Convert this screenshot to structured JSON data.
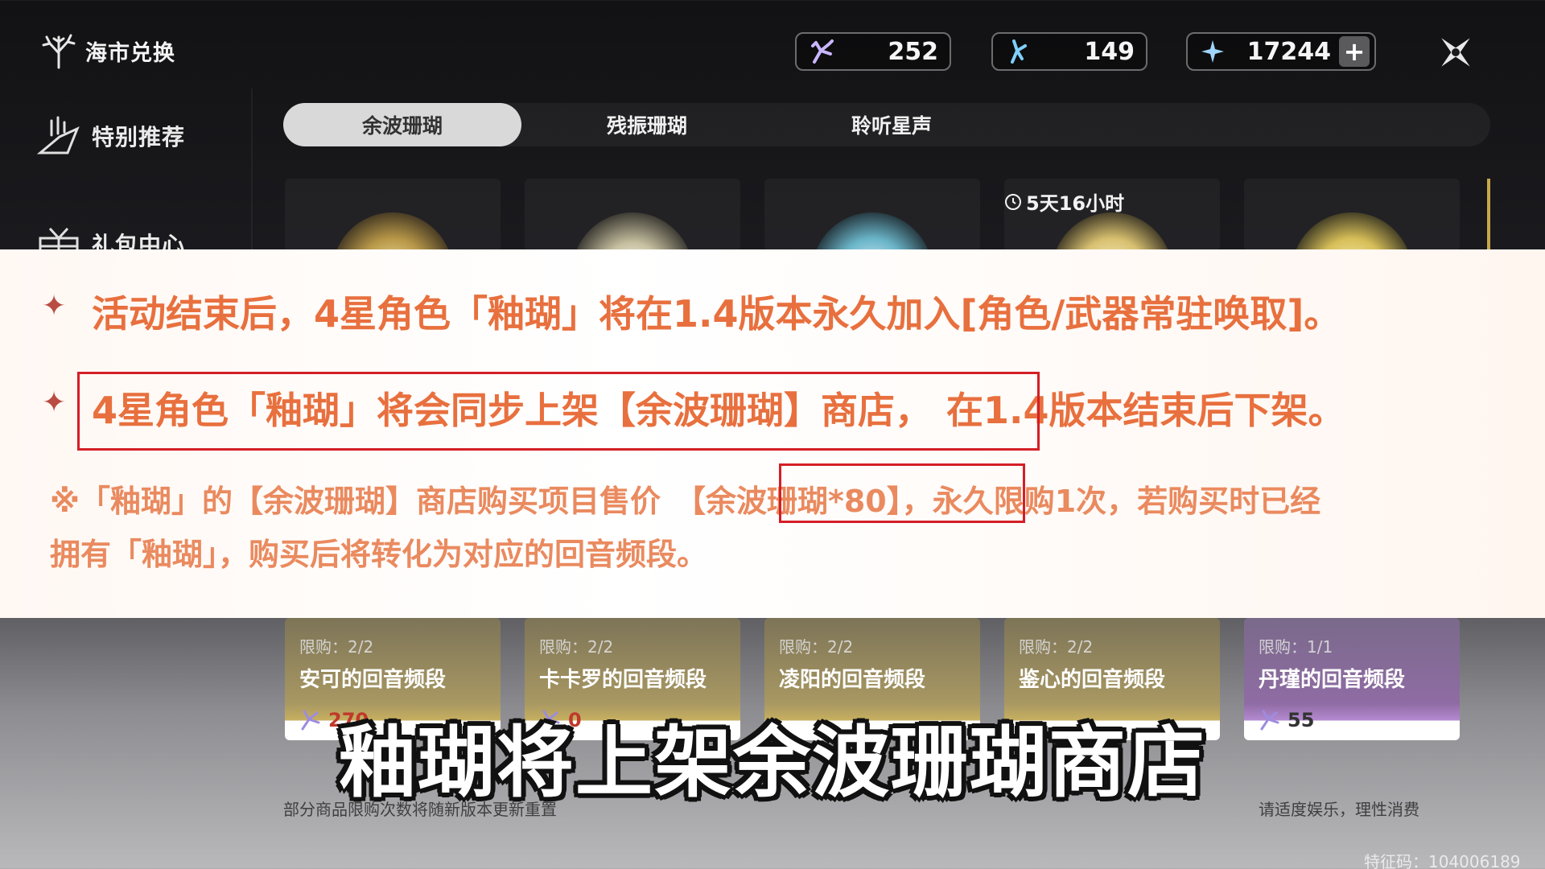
{
  "header": {
    "shop_title": "海市兑换"
  },
  "currencies": [
    {
      "icon": "coral-currency-icon",
      "value": "252"
    },
    {
      "icon": "blue-coral-currency-icon",
      "value": "149"
    },
    {
      "icon": "star-currency-icon",
      "value": "17244",
      "plus": "+"
    }
  ],
  "sidebar": {
    "items": [
      {
        "label": "特别推荐"
      },
      {
        "label": "礼包中心"
      }
    ]
  },
  "tabs": [
    {
      "label": "余波珊瑚",
      "active": true
    },
    {
      "label": "残振珊瑚",
      "active": false
    },
    {
      "label": "聆听星声",
      "active": false
    }
  ],
  "timer": {
    "text": "5天16小时"
  },
  "cards": [
    {
      "limit": "限购：2/2",
      "name": "安可的回音频段",
      "price": "270"
    },
    {
      "limit": "限购：2/2",
      "name": "卡卡罗的回音频段",
      "price": "0"
    },
    {
      "limit": "限购：2/2",
      "name": "凌阳的回音频段",
      "price": ""
    },
    {
      "limit": "限购：2/2",
      "name": "鉴心的回音频段",
      "price": ""
    },
    {
      "limit": "限购：1/1",
      "name": "丹瑾的回音频段",
      "price": "55"
    }
  ],
  "notice": {
    "bullet": "✦",
    "line1": "活动结束后，4星角色「釉瑚」将在1.4版本永久加入[角色/武器常驻唤取]。",
    "line2_boxed": "4星角色「釉瑚」将会同步上架【余波珊瑚】商店，",
    "line2_rest": "在1.4版本结束后下架。",
    "line3_pre": "※「釉瑚」的【余波珊瑚】商店购买项目售价",
    "line3_boxed": "【余波珊瑚*80】",
    "line3_post": "，永久限购1次，若购买时已经",
    "line4": "拥有「釉瑚」，购买后将转化为对应的回音频段。"
  },
  "footer": {
    "left_note": "部分商品限购次数将随新版本更新重置",
    "right_note": "请适度娱乐，理性消费",
    "watermark": "特征码：104006189"
  },
  "caption": "釉瑚将上架余波珊瑚商店",
  "colors": {
    "accent_orange": "#e8703e",
    "highlight_red": "#d41f26",
    "gold": "#c8b060",
    "purple": "#b58ad2"
  }
}
